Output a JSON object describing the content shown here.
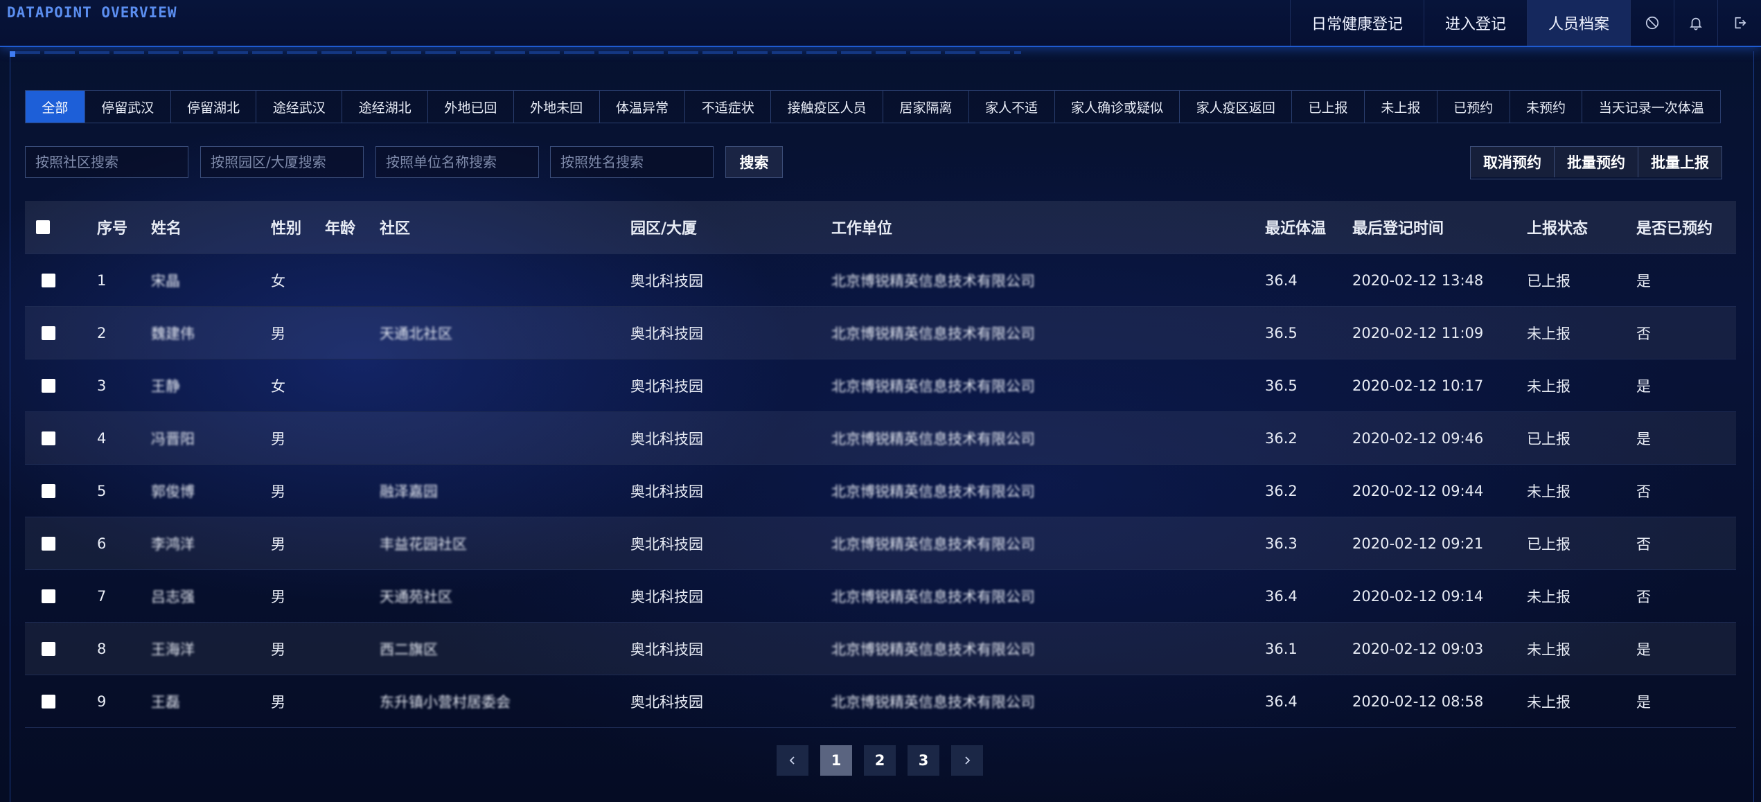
{
  "app": {
    "brand": "DATAPOINT OVERVIEW"
  },
  "topnav": {
    "items": [
      {
        "label": "日常健康登记"
      },
      {
        "label": "进入登记"
      },
      {
        "label": "人员档案",
        "active": true
      }
    ],
    "icons": [
      "no-entry-icon",
      "bell-icon",
      "logout-icon"
    ]
  },
  "filters": {
    "tabs": [
      "全部",
      "停留武汉",
      "停留湖北",
      "途经武汉",
      "途经湖北",
      "外地已回",
      "外地未回",
      "体温异常",
      "不适症状",
      "接触疫区人员",
      "居家隔离",
      "家人不适",
      "家人确诊或疑似",
      "家人疫区返回",
      "已上报",
      "未上报",
      "已预约",
      "未预约",
      "当天记录一次体温"
    ],
    "active_index": 0
  },
  "search": {
    "community_placeholder": "按照社区搜索",
    "park_placeholder": "按照园区/大厦搜索",
    "company_placeholder": "按照单位名称搜索",
    "name_placeholder": "按照姓名搜索",
    "button_label": "搜索"
  },
  "actions": {
    "cancel_reserve": "取消预约",
    "batch_reserve": "批量预约",
    "batch_report": "批量上报"
  },
  "table": {
    "columns": {
      "index": "序号",
      "name": "姓名",
      "gender": "性别",
      "age": "年龄",
      "community": "社区",
      "park": "园区/大厦",
      "company": "工作单位",
      "temp": "最近体温",
      "last_time": "最后登记时间",
      "report_status": "上报状态",
      "reserved": "是否已预约"
    },
    "rows": [
      {
        "index": "1",
        "name": "宋晶",
        "gender": "女",
        "age": "",
        "community": "",
        "park": "奥北科技园",
        "company": "北京博锐精英信息技术有限公司",
        "temp": "36.4",
        "last_time": "2020-02-12 13:48",
        "report_status": "已上报",
        "reserved": "是"
      },
      {
        "index": "2",
        "name": "魏建伟",
        "gender": "男",
        "age": "",
        "community": "天通北社区",
        "park": "奥北科技园",
        "company": "北京博锐精英信息技术有限公司",
        "temp": "36.5",
        "last_time": "2020-02-12 11:09",
        "report_status": "未上报",
        "reserved": "否"
      },
      {
        "index": "3",
        "name": "王静",
        "gender": "女",
        "age": "",
        "community": "",
        "park": "奥北科技园",
        "company": "北京博锐精英信息技术有限公司",
        "temp": "36.5",
        "last_time": "2020-02-12 10:17",
        "report_status": "未上报",
        "reserved": "是"
      },
      {
        "index": "4",
        "name": "冯晋阳",
        "gender": "男",
        "age": "",
        "community": "",
        "park": "奥北科技园",
        "company": "北京博锐精英信息技术有限公司",
        "temp": "36.2",
        "last_time": "2020-02-12 09:46",
        "report_status": "已上报",
        "reserved": "是"
      },
      {
        "index": "5",
        "name": "郭俊博",
        "gender": "男",
        "age": "",
        "community": "融泽嘉园",
        "park": "奥北科技园",
        "company": "北京博锐精英信息技术有限公司",
        "temp": "36.2",
        "last_time": "2020-02-12 09:44",
        "report_status": "未上报",
        "reserved": "否"
      },
      {
        "index": "6",
        "name": "李鸿洋",
        "gender": "男",
        "age": "",
        "community": "丰益花园社区",
        "park": "奥北科技园",
        "company": "北京博锐精英信息技术有限公司",
        "temp": "36.3",
        "last_time": "2020-02-12 09:21",
        "report_status": "已上报",
        "reserved": "否"
      },
      {
        "index": "7",
        "name": "吕志强",
        "gender": "男",
        "age": "",
        "community": "天通苑社区",
        "park": "奥北科技园",
        "company": "北京博锐精英信息技术有限公司",
        "temp": "36.4",
        "last_time": "2020-02-12 09:14",
        "report_status": "未上报",
        "reserved": "否"
      },
      {
        "index": "8",
        "name": "王海洋",
        "gender": "男",
        "age": "",
        "community": "西二旗区",
        "park": "奥北科技园",
        "company": "北京博锐精英信息技术有限公司",
        "temp": "36.1",
        "last_time": "2020-02-12 09:03",
        "report_status": "未上报",
        "reserved": "是"
      },
      {
        "index": "9",
        "name": "王磊",
        "gender": "男",
        "age": "",
        "community": "东升镇小营村居委会",
        "park": "奥北科技园",
        "company": "北京博锐精英信息技术有限公司",
        "temp": "36.4",
        "last_time": "2020-02-12 08:58",
        "report_status": "未上报",
        "reserved": "是"
      }
    ]
  },
  "pagination": {
    "pages": [
      "1",
      "2",
      "3"
    ],
    "current": "1"
  },
  "colors": {
    "accent": "#1d5fd8",
    "brand": "#5b8ef0",
    "background": "#07102a"
  }
}
